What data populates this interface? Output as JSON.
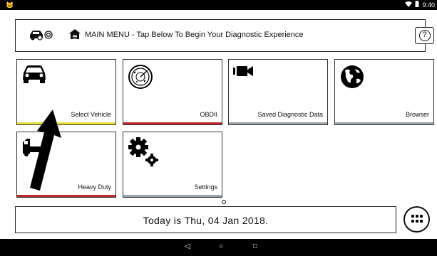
{
  "status_bar": {
    "time": "9:40",
    "notification_icon": "cat-icon"
  },
  "header": {
    "title": "MAIN MENU - Tap Below To Begin Your Diagnostic Experience",
    "help_label": "?",
    "icons": [
      "car-key-icon",
      "home-icon"
    ]
  },
  "tiles": [
    {
      "label": "Select Vehicle",
      "icon": "car-icon",
      "accent": "#e6df3a"
    },
    {
      "label": "OBDII",
      "icon": "radar-icon",
      "accent": "#c0272d"
    },
    {
      "label": "Saved Diagnostic Data",
      "icon": "camera-icon",
      "accent": "#9aa5ab"
    },
    {
      "label": "Browser",
      "icon": "globe-icon",
      "accent": "#9aa5ab"
    },
    {
      "label": "Heavy Duty",
      "icon": "truck-icon",
      "accent": "#c0272d"
    },
    {
      "label": "Settings",
      "icon": "gears-icon",
      "accent": "#9aa5ab"
    }
  ],
  "footer": {
    "date_text": "Today is Thu, 04 Jan 2018."
  },
  "nav": {
    "back": "◁",
    "home": "○",
    "recents": "□"
  }
}
